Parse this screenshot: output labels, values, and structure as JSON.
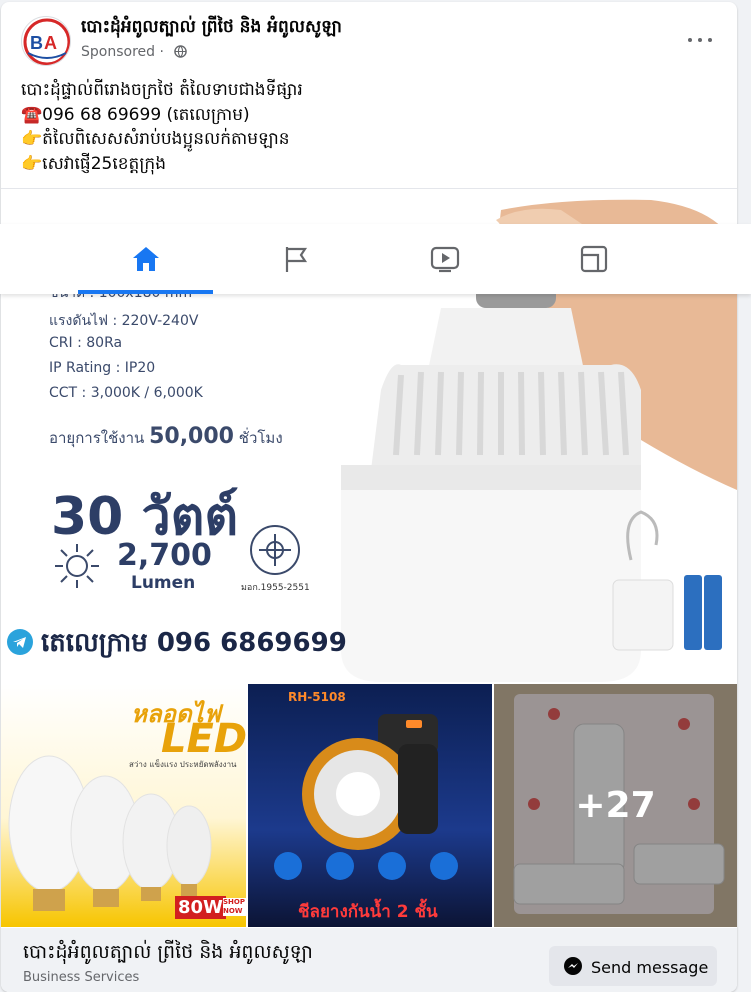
{
  "post": {
    "page_name": "បោះដុំអំពូលត្បាល់ ព្រីថៃ និង អំពូលសូឡា",
    "sponsored_label": "Sponsored",
    "body_lines": [
      "បោះដុំផ្ទាល់ពីរោងចក្រថៃ តំលៃទាបជាងទីផ្សារ",
      "☎️096 68 69699 (តេលេក្រាម)",
      "👉តំលៃពិសេសសំរាប់បងប្អូនលក់តាមឡាន",
      "👉សេវាផ្ញើ25ខេត្តក្រុង"
    ]
  },
  "hero_image": {
    "specs": [
      "ขนาด : 100x180 mm",
      "แรงดันไฟ : 220V-240V",
      "CRI : 80Ra",
      "IP Rating : IP20",
      "CCT : 3,000K / 6,000K"
    ],
    "lifetime_label": "อายุการใช้งาน",
    "lifetime_value": "50,000",
    "lifetime_unit": "ชั่วโมง",
    "watt": "30 วัตต์",
    "lumen_value": "2,700",
    "lumen_unit": "Lumen",
    "cert": "มอก.1955-2551",
    "telegram_line": "តេលេក្រាម 096 6869699"
  },
  "thumbnails": {
    "first": {
      "top_text": "หลอดไฟ",
      "big_text": "LED",
      "sub_text": "สว่าง แข็งแรง ประหยัดพลังงาน",
      "watt": "80W",
      "shop_now": "SHOP NOW"
    },
    "second": {
      "model": "RH-5108",
      "bottom_text": "ชีลยางกันน้ำ 2 ชั้น"
    },
    "third": {
      "more_count": "+27"
    }
  },
  "footer": {
    "title": "បោះដុំអំពូលត្បាល់ ព្រីថៃ និង អំពូលសូឡា",
    "subtitle": "Business Services",
    "send_message_label": "Send message"
  },
  "navbar": {
    "tabs": [
      "home",
      "pages",
      "watch",
      "feeds"
    ],
    "active": "home",
    "accent_color": "#1877f2"
  }
}
